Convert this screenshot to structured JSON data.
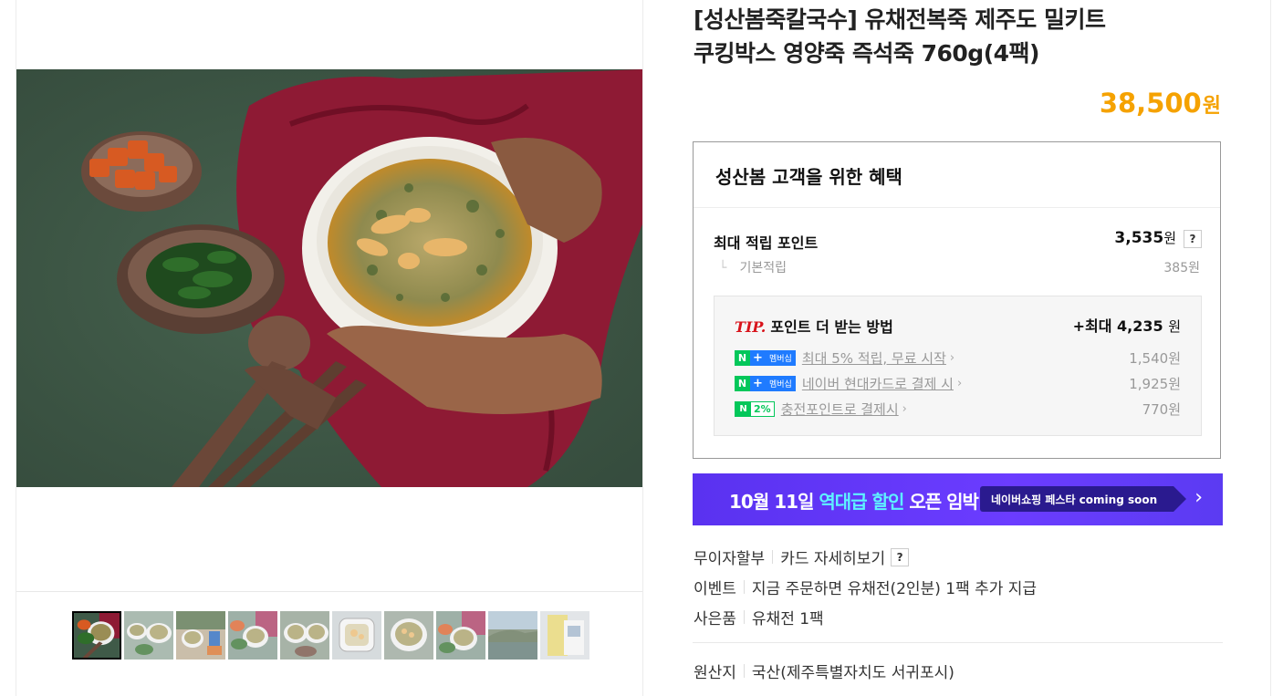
{
  "product": {
    "title_line1": "[성산봄죽칼국수] 유채전복죽 제주도 밀키트",
    "title_line2": "쿠킹박스 영양죽 즉석죽 760g(4팩)",
    "price": "38,500",
    "price_unit": "원",
    "accent_color": "#f5a200"
  },
  "benefit": {
    "title": "성산봄 고객을 위한 혜택",
    "max_point_label": "최대 적립 포인트",
    "max_point_value": "3,535",
    "unit": "원",
    "help": "?",
    "basic_label": "기본적립",
    "basic_value": "385원",
    "tip": {
      "badge": "TIP.",
      "title": "포인트 더 받는 방법",
      "max": "+최대 4,235",
      "unit": "원",
      "rows": [
        {
          "badge": "멤버십",
          "text": "최대 5% 적립, 무료 시작",
          "value": "1,540원"
        },
        {
          "badge": "멤버십",
          "text": "네이버 현대카드로 결제 시",
          "value": "1,925원"
        },
        {
          "badge": "2%",
          "text": "충전포인트로 결제시",
          "value": "770원"
        }
      ]
    }
  },
  "banner": {
    "text_a": "10월 11일 ",
    "text_b": "역대급 할인",
    "text_c": " 오픈 임박!",
    "tag": "네이버쇼핑 페스타 coming soon",
    "arrow": "›"
  },
  "info": {
    "installment_label": "무이자할부",
    "installment_link": "카드 자세히보기",
    "help": "?",
    "event_label": "이벤트",
    "event_text": "지금 주문하면 유채전(2인분) 1팩 추가 지급",
    "gift_label": "사은품",
    "gift_text": "유채전 1팩",
    "origin_label": "원산지",
    "origin_text": "국산(제주특별자치도 서귀포시)"
  },
  "gallery": {
    "thumb_count": 10,
    "active_index": 0
  },
  "icons": {
    "n_badge": "N",
    "plus_badge": "+",
    "chevron": "›"
  }
}
